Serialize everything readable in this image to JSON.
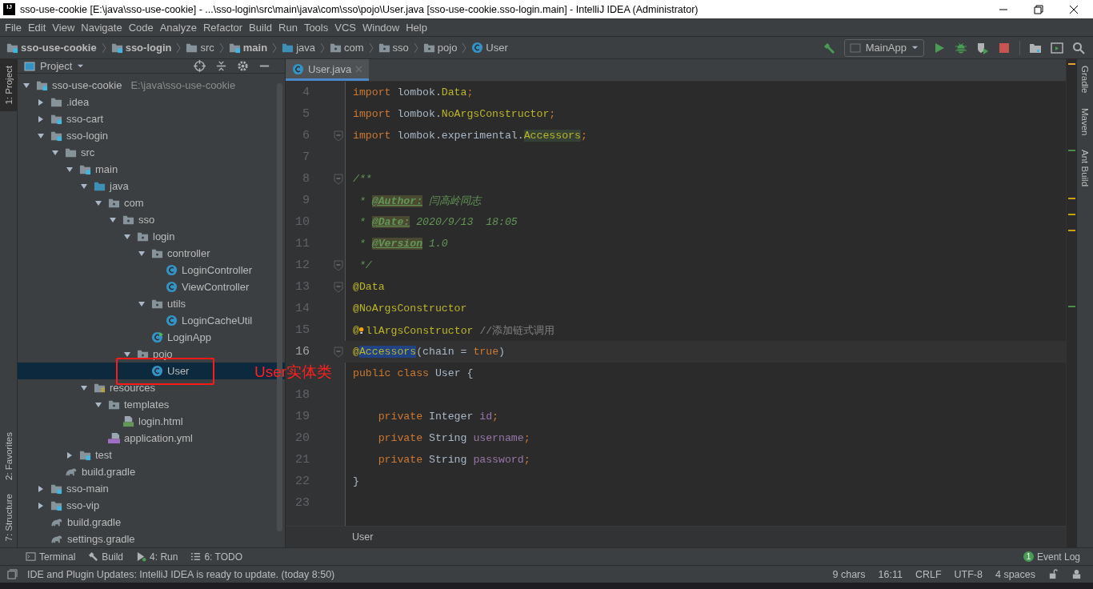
{
  "window": {
    "logo": "IJ",
    "title": "sso-use-cookie [E:\\java\\sso-use-cookie] - ...\\sso-login\\src\\main\\java\\com\\sso\\pojo\\User.java [sso-use-cookie.sso-login.main] - IntelliJ IDEA (Administrator)"
  },
  "menu": [
    "File",
    "Edit",
    "View",
    "Navigate",
    "Code",
    "Analyze",
    "Refactor",
    "Build",
    "Run",
    "Tools",
    "VCS",
    "Window",
    "Help"
  ],
  "breadcrumbs": [
    {
      "label": "sso-use-cookie",
      "kind": "module",
      "bold": true
    },
    {
      "label": "sso-login",
      "kind": "module",
      "bold": true
    },
    {
      "label": "src",
      "kind": "folder",
      "bold": false
    },
    {
      "label": "main",
      "kind": "module",
      "bold": true
    },
    {
      "label": "java",
      "kind": "source",
      "bold": false
    },
    {
      "label": "com",
      "kind": "package",
      "bold": false
    },
    {
      "label": "sso",
      "kind": "package",
      "bold": false
    },
    {
      "label": "pojo",
      "kind": "package",
      "bold": false
    },
    {
      "label": "User",
      "kind": "class",
      "bold": false
    }
  ],
  "run_config": "MainApp",
  "left_stripe": [
    {
      "label": "1: Project",
      "selected": true
    },
    {
      "label": "2: Favorites",
      "selected": false
    },
    {
      "label": "7: Structure",
      "selected": false
    }
  ],
  "right_stripe": [
    "Gradle",
    "Maven",
    "Ant Build"
  ],
  "project": {
    "title": "Project",
    "tree": [
      {
        "label": "sso-use-cookie",
        "hint": "E:\\java\\sso-use-cookie",
        "kind": "module",
        "expanded": true,
        "selected": false,
        "children": [
          {
            "label": ".idea",
            "kind": "folder",
            "expanded": false,
            "selected": false
          },
          {
            "label": "sso-cart",
            "kind": "module",
            "expanded": false,
            "selected": false
          },
          {
            "label": "sso-login",
            "kind": "module",
            "expanded": true,
            "selected": false,
            "children": [
              {
                "label": "src",
                "kind": "folder",
                "expanded": true,
                "selected": false,
                "children": [
                  {
                    "label": "main",
                    "kind": "module",
                    "expanded": true,
                    "selected": false,
                    "children": [
                      {
                        "label": "java",
                        "kind": "source",
                        "expanded": true,
                        "selected": false,
                        "children": [
                          {
                            "label": "com",
                            "kind": "package",
                            "expanded": true,
                            "selected": false,
                            "children": [
                              {
                                "label": "sso",
                                "kind": "package",
                                "expanded": true,
                                "selected": false,
                                "children": [
                                  {
                                    "label": "login",
                                    "kind": "package",
                                    "expanded": true,
                                    "selected": false,
                                    "children": [
                                      {
                                        "label": "controller",
                                        "kind": "package",
                                        "expanded": true,
                                        "selected": false,
                                        "children": [
                                          {
                                            "label": "LoginController",
                                            "kind": "class",
                                            "selected": false
                                          },
                                          {
                                            "label": "ViewController",
                                            "kind": "class",
                                            "selected": false
                                          }
                                        ]
                                      },
                                      {
                                        "label": "utils",
                                        "kind": "package",
                                        "expanded": true,
                                        "selected": false,
                                        "children": [
                                          {
                                            "label": "LoginCacheUtil",
                                            "kind": "class",
                                            "selected": false
                                          }
                                        ]
                                      },
                                      {
                                        "label": "LoginApp",
                                        "kind": "app",
                                        "selected": false
                                      }
                                    ]
                                  },
                                  {
                                    "label": "pojo",
                                    "kind": "package",
                                    "expanded": true,
                                    "selected": false,
                                    "children": [
                                      {
                                        "label": "User",
                                        "kind": "class",
                                        "selected": true
                                      }
                                    ]
                                  }
                                ]
                              }
                            ]
                          }
                        ]
                      },
                      {
                        "label": "resources",
                        "kind": "resources",
                        "expanded": true,
                        "selected": false,
                        "children": [
                          {
                            "label": "templates",
                            "kind": "package",
                            "expanded": true,
                            "selected": false,
                            "children": [
                              {
                                "label": "login.html",
                                "kind": "html",
                                "selected": false
                              }
                            ]
                          },
                          {
                            "label": "application.yml",
                            "kind": "yml",
                            "selected": false
                          }
                        ]
                      }
                    ]
                  },
                  {
                    "label": "test",
                    "kind": "module",
                    "expanded": false,
                    "selected": false
                  }
                ]
              },
              {
                "label": "build.gradle",
                "kind": "gradle",
                "selected": false
              }
            ]
          },
          {
            "label": "sso-main",
            "kind": "module",
            "expanded": false,
            "selected": false
          },
          {
            "label": "sso-vip",
            "kind": "module",
            "expanded": false,
            "selected": false
          },
          {
            "label": "build.gradle",
            "kind": "gradle",
            "selected": false
          },
          {
            "label": "settings.gradle",
            "kind": "gradle",
            "selected": false
          }
        ]
      }
    ]
  },
  "editor": {
    "tab": "User.java",
    "lines": [
      {
        "number": "4",
        "current": false,
        "fold": false,
        "tokens": [
          {
            "text": "import",
            "kind": "kw"
          },
          {
            "text": " lombok.",
            "kind": "plain"
          },
          {
            "text": "Data",
            "kind": "ann"
          },
          {
            "text": ";",
            "kind": "kw"
          }
        ]
      },
      {
        "number": "5",
        "current": false,
        "fold": false,
        "tokens": [
          {
            "text": "import",
            "kind": "kw"
          },
          {
            "text": " lombok.",
            "kind": "plain"
          },
          {
            "text": "NoArgsConstructor",
            "kind": "ann"
          },
          {
            "text": ";",
            "kind": "kw"
          }
        ]
      },
      {
        "number": "6",
        "current": false,
        "fold": true,
        "tokens": [
          {
            "text": "import",
            "kind": "kw"
          },
          {
            "text": " lombok.experimental.",
            "kind": "plain"
          },
          {
            "text": "Accessors",
            "kind": "ann-match"
          },
          {
            "text": ";",
            "kind": "kw"
          }
        ]
      },
      {
        "number": "7",
        "current": false,
        "fold": false
      },
      {
        "number": "8",
        "current": false,
        "fold": true,
        "tokens": [
          {
            "text": "/**",
            "kind": "doc"
          }
        ]
      },
      {
        "number": "9",
        "current": false,
        "fold": false,
        "tokens": [
          {
            "text": " * ",
            "kind": "doc"
          },
          {
            "text": "@Author:",
            "kind": "doctag"
          },
          {
            "text": " 闫高岭同志",
            "kind": "doc"
          }
        ]
      },
      {
        "number": "10",
        "current": false,
        "fold": false,
        "tokens": [
          {
            "text": " * ",
            "kind": "doc"
          },
          {
            "text": "@Date:",
            "kind": "doctag"
          },
          {
            "text": " 2020/9/13  18:05",
            "kind": "doc"
          }
        ]
      },
      {
        "number": "11",
        "current": false,
        "fold": false,
        "tokens": [
          {
            "text": " * ",
            "kind": "doc"
          },
          {
            "text": "@Version",
            "kind": "doctag"
          },
          {
            "text": " 1.0",
            "kind": "doc"
          }
        ]
      },
      {
        "number": "12",
        "current": false,
        "fold": true,
        "tokens": [
          {
            "text": " */",
            "kind": "doc"
          }
        ]
      },
      {
        "number": "13",
        "current": false,
        "fold": true,
        "tokens": [
          {
            "text": "@Data",
            "kind": "ann"
          }
        ]
      },
      {
        "number": "14",
        "current": false,
        "fold": false,
        "tokens": [
          {
            "text": "@NoArgsConstructor",
            "kind": "ann"
          }
        ]
      },
      {
        "number": "15",
        "current": false,
        "fold": false,
        "tokens": [
          {
            "text": "@",
            "kind": "ann"
          },
          {
            "kind": "bulb"
          },
          {
            "text": "llArgsConstructor",
            "kind": "ann"
          },
          {
            "text": " //添加链式调用",
            "kind": "comment"
          }
        ]
      },
      {
        "number": "16",
        "current": true,
        "fold": true,
        "tokens": [
          {
            "text": "@",
            "kind": "ann"
          },
          {
            "text": "Accessors",
            "kind": "ann-selected"
          },
          {
            "text": "(chain = ",
            "kind": "plain"
          },
          {
            "text": "true",
            "kind": "kw"
          },
          {
            "text": ")",
            "kind": "plain"
          }
        ]
      },
      {
        "current": false,
        "fold": false,
        "tokens": [
          {
            "text": "public class ",
            "kind": "kw"
          },
          {
            "text": "User {",
            "kind": "plain"
          }
        ]
      },
      {
        "number": "18",
        "current": false,
        "fold": false
      },
      {
        "number": "19",
        "current": false,
        "fold": false,
        "tokens": [
          {
            "text": "    private ",
            "kind": "kw"
          },
          {
            "text": "Integer ",
            "kind": "plain"
          },
          {
            "text": "id",
            "kind": "field"
          },
          {
            "text": ";",
            "kind": "kw"
          }
        ]
      },
      {
        "number": "20",
        "current": false,
        "fold": false,
        "tokens": [
          {
            "text": "    private ",
            "kind": "kw"
          },
          {
            "text": "String ",
            "kind": "plain"
          },
          {
            "text": "username",
            "kind": "field"
          },
          {
            "text": ";",
            "kind": "kw"
          }
        ]
      },
      {
        "number": "21",
        "current": false,
        "fold": false,
        "tokens": [
          {
            "text": "    private ",
            "kind": "kw"
          },
          {
            "text": "String ",
            "kind": "plain"
          },
          {
            "text": "password",
            "kind": "field"
          },
          {
            "text": ";",
            "kind": "kw"
          }
        ]
      },
      {
        "number": "22",
        "current": false,
        "fold": false,
        "tokens": [
          {
            "text": "}",
            "kind": "plain"
          }
        ]
      },
      {
        "number": "23",
        "current": false,
        "fold": false
      }
    ],
    "breadcrumb": "User"
  },
  "annotation": {
    "text": "User实体类"
  },
  "tool_buttons": [
    {
      "label": "Terminal",
      "kind": "terminal"
    },
    {
      "label": "Build",
      "kind": "build"
    },
    {
      "label": "4: Run",
      "kind": "run"
    },
    {
      "label": "6: TODO",
      "kind": "todo"
    }
  ],
  "event_log": {
    "label": "Event Log",
    "count": "1"
  },
  "status_bar": {
    "message": "IDE and Plugin Updates: IntelliJ IDEA is ready to update. (today 8:50)",
    "items": [
      "9 chars",
      "16:11",
      "CRLF",
      "UTF-8",
      "4 spaces"
    ]
  }
}
